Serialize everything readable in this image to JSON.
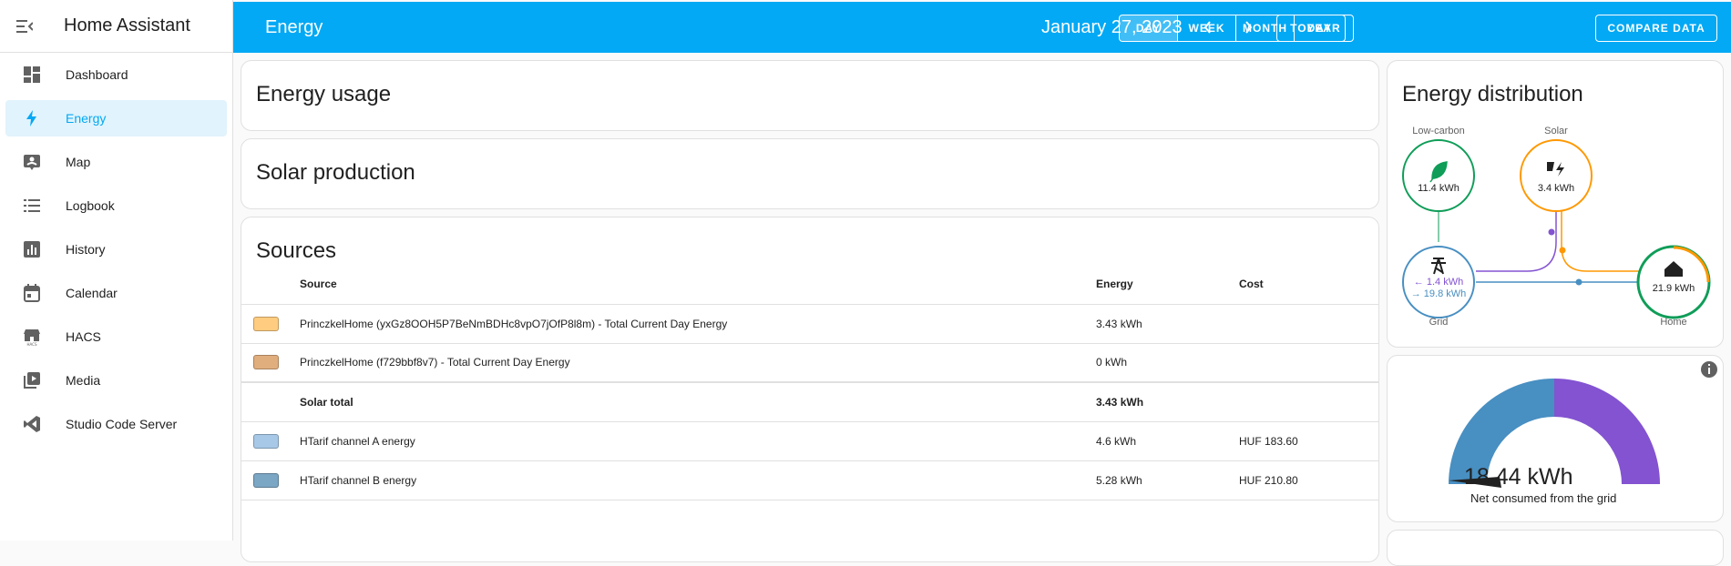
{
  "app": {
    "title": "Home Assistant"
  },
  "sidebar": {
    "items": [
      {
        "label": "Dashboard"
      },
      {
        "label": "Energy"
      },
      {
        "label": "Map"
      },
      {
        "label": "Logbook"
      },
      {
        "label": "History"
      },
      {
        "label": "Calendar"
      },
      {
        "label": "HACS"
      },
      {
        "label": "Media"
      },
      {
        "label": "Studio Code Server"
      }
    ]
  },
  "topbar": {
    "title": "Energy",
    "date": "January 27, 2023",
    "today": "TODAY",
    "periods": [
      "DAY",
      "WEEK",
      "MONTH",
      "YEAR"
    ],
    "selected_period": "DAY",
    "compare": "COMPARE DATA"
  },
  "cards": {
    "usage_title": "Energy usage",
    "solar_title": "Solar production",
    "sources_title": "Sources",
    "distribution_title": "Energy distribution"
  },
  "sources": {
    "headers": {
      "source": "Source",
      "energy": "Energy",
      "cost": "Cost"
    },
    "rows": [
      {
        "color": "#ffcc80",
        "source": "PrinczkelHome (yxGz8OOH5P7BeNmBDHc8vpO7jOfP8l8m) - Total Current Day Energy",
        "energy": "3.43 kWh",
        "cost": ""
      },
      {
        "color": "#e0ae7d",
        "source": "PrinczkelHome (f729bbf8v7) - Total Current Day Energy",
        "energy": "0 kWh",
        "cost": ""
      },
      {
        "color": "",
        "source": "Solar total",
        "energy": "3.43 kWh",
        "cost": "",
        "total": true
      },
      {
        "color": "#a7c8e6",
        "source": "HTarif channel A energy",
        "energy": "4.6 kWh",
        "cost": "HUF 183.60"
      },
      {
        "color": "#7ba6c4",
        "source": "HTarif channel B energy",
        "energy": "5.28 kWh",
        "cost": "HUF 210.80"
      }
    ]
  },
  "distribution": {
    "low_carbon_label": "Low-carbon",
    "low_carbon_value": "11.4 kWh",
    "solar_label": "Solar",
    "solar_value": "3.4 kWh",
    "grid_label": "Grid",
    "grid_in": "← 1.4 kWh",
    "grid_out": "→ 19.8 kWh",
    "home_label": "Home",
    "home_value": "21.9 kWh",
    "colors": {
      "low_carbon": "#0f9d58",
      "solar": "#ff9800",
      "grid_return": "#8353d1",
      "grid_consumption": "#488fc2"
    }
  },
  "gauge": {
    "value": "18.44 kWh",
    "label": "Net consumed from the grid"
  }
}
